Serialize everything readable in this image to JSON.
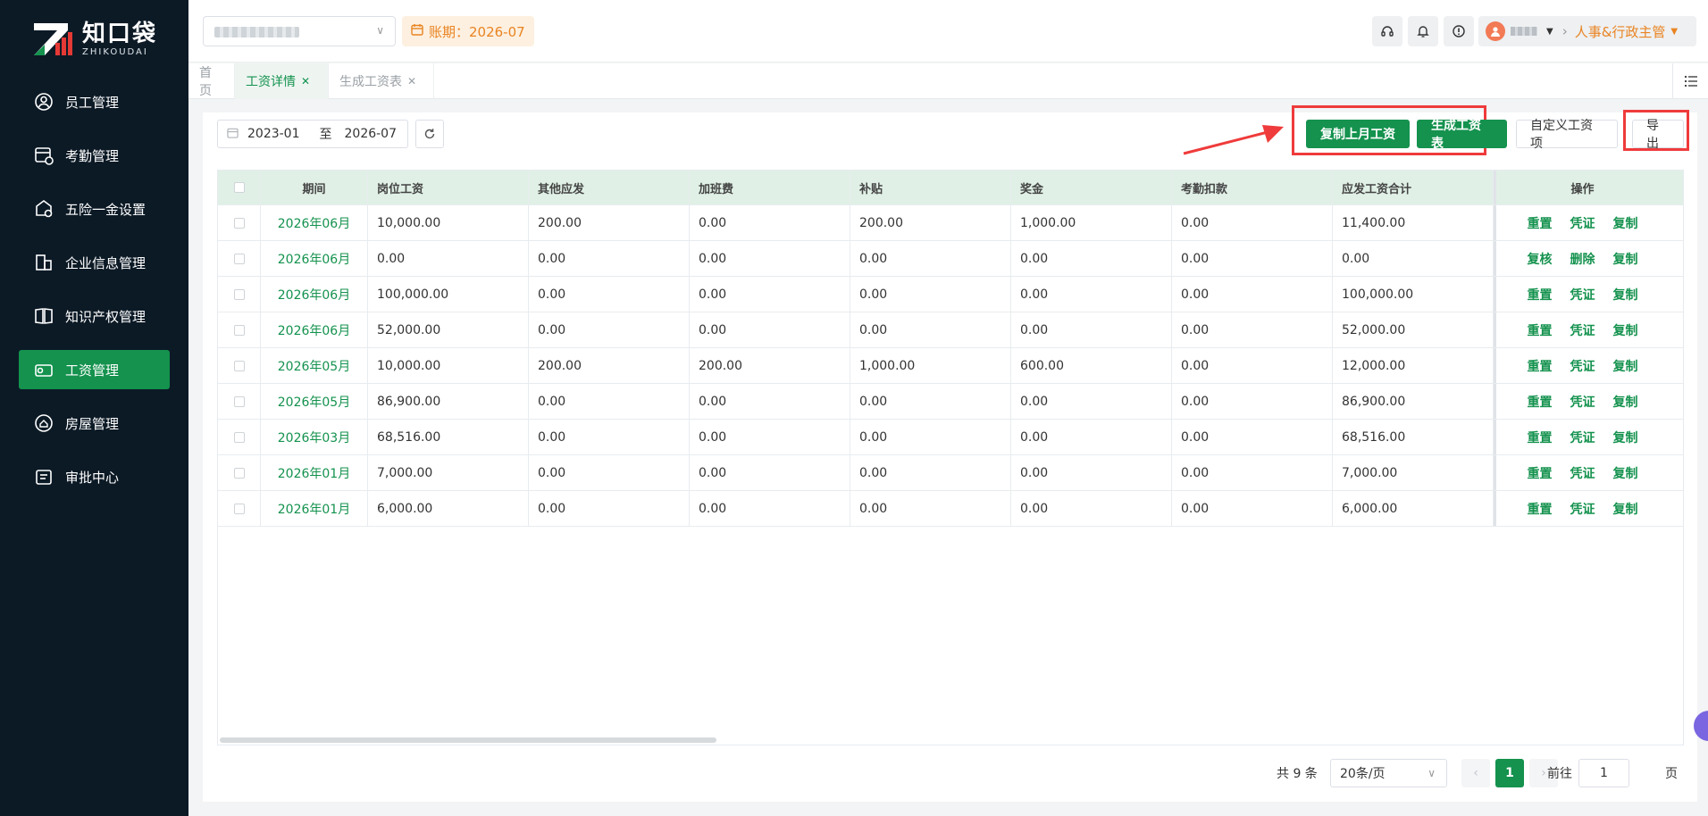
{
  "logo": {
    "cn": "知口袋",
    "en": "ZHIKOUDAI"
  },
  "sidebar": {
    "items": [
      {
        "label": "员工管理",
        "icon": "employee-icon",
        "active": false
      },
      {
        "label": "考勤管理",
        "icon": "attendance-icon",
        "active": false
      },
      {
        "label": "五险一金设置",
        "icon": "insurance-icon",
        "active": false
      },
      {
        "label": "企业信息管理",
        "icon": "enterprise-icon",
        "active": false
      },
      {
        "label": "知识产权管理",
        "icon": "book-icon",
        "active": false
      },
      {
        "label": "工资管理",
        "icon": "salary-icon",
        "active": true
      },
      {
        "label": "房屋管理",
        "icon": "house-icon",
        "active": false
      },
      {
        "label": "审批中心",
        "icon": "approval-icon",
        "active": false
      }
    ]
  },
  "header": {
    "period_label": "账期：2026-07",
    "role": "人事&行政主管",
    "icons": [
      "headset-icon",
      "bell-icon",
      "info-icon"
    ]
  },
  "tabs": [
    {
      "label": "首页",
      "active": false,
      "closable": false
    },
    {
      "label": "工资详情",
      "active": true,
      "closable": true
    },
    {
      "label": "生成工资表",
      "active": false,
      "closable": true
    }
  ],
  "toolbar": {
    "date_start": "2023-01",
    "date_sep": "至",
    "date_end": "2026-07",
    "copy_last_month": "复制上月工资",
    "generate_sheet": "生成工资表",
    "custom_items": "自定义工资项",
    "export": "导出"
  },
  "table": {
    "headers": [
      "期间",
      "岗位工资",
      "其他应发",
      "加班费",
      "补贴",
      "奖金",
      "考勤扣款",
      "应发工资合计",
      "操作"
    ],
    "rows": [
      {
        "period": "2026年06月",
        "vals": [
          "10,000.00",
          "200.00",
          "0.00",
          "200.00",
          "1,000.00",
          "0.00",
          "11,400.00"
        ],
        "ops": [
          "重置",
          "凭证",
          "复制"
        ]
      },
      {
        "period": "2026年06月",
        "vals": [
          "0.00",
          "0.00",
          "0.00",
          "0.00",
          "0.00",
          "0.00",
          "0.00"
        ],
        "ops": [
          "复核",
          "删除",
          "复制"
        ]
      },
      {
        "period": "2026年06月",
        "vals": [
          "100,000.00",
          "0.00",
          "0.00",
          "0.00",
          "0.00",
          "0.00",
          "100,000.00"
        ],
        "ops": [
          "重置",
          "凭证",
          "复制"
        ]
      },
      {
        "period": "2026年06月",
        "vals": [
          "52,000.00",
          "0.00",
          "0.00",
          "0.00",
          "0.00",
          "0.00",
          "52,000.00"
        ],
        "ops": [
          "重置",
          "凭证",
          "复制"
        ]
      },
      {
        "period": "2026年05月",
        "vals": [
          "10,000.00",
          "200.00",
          "200.00",
          "1,000.00",
          "600.00",
          "0.00",
          "12,000.00"
        ],
        "ops": [
          "重置",
          "凭证",
          "复制"
        ]
      },
      {
        "period": "2026年05月",
        "vals": [
          "86,900.00",
          "0.00",
          "0.00",
          "0.00",
          "0.00",
          "0.00",
          "86,900.00"
        ],
        "ops": [
          "重置",
          "凭证",
          "复制"
        ]
      },
      {
        "period": "2026年03月",
        "vals": [
          "68,516.00",
          "0.00",
          "0.00",
          "0.00",
          "0.00",
          "0.00",
          "68,516.00"
        ],
        "ops": [
          "重置",
          "凭证",
          "复制"
        ]
      },
      {
        "period": "2026年01月",
        "vals": [
          "7,000.00",
          "0.00",
          "0.00",
          "0.00",
          "0.00",
          "0.00",
          "7,000.00"
        ],
        "ops": [
          "重置",
          "凭证",
          "复制"
        ]
      },
      {
        "period": "2026年01月",
        "vals": [
          "6,000.00",
          "0.00",
          "0.00",
          "0.00",
          "0.00",
          "0.00",
          "6,000.00"
        ],
        "ops": [
          "重置",
          "凭证",
          "复制"
        ]
      }
    ]
  },
  "pagination": {
    "total": "共 9 条",
    "page_size": "20条/页",
    "current": "1",
    "goto_label": "前往",
    "goto_value": "1",
    "page_unit": "页"
  },
  "colors": {
    "brand": "#14924e",
    "sidebar": "#0c1a26",
    "highlight": "#ef3b3b",
    "period": "#e98422"
  }
}
